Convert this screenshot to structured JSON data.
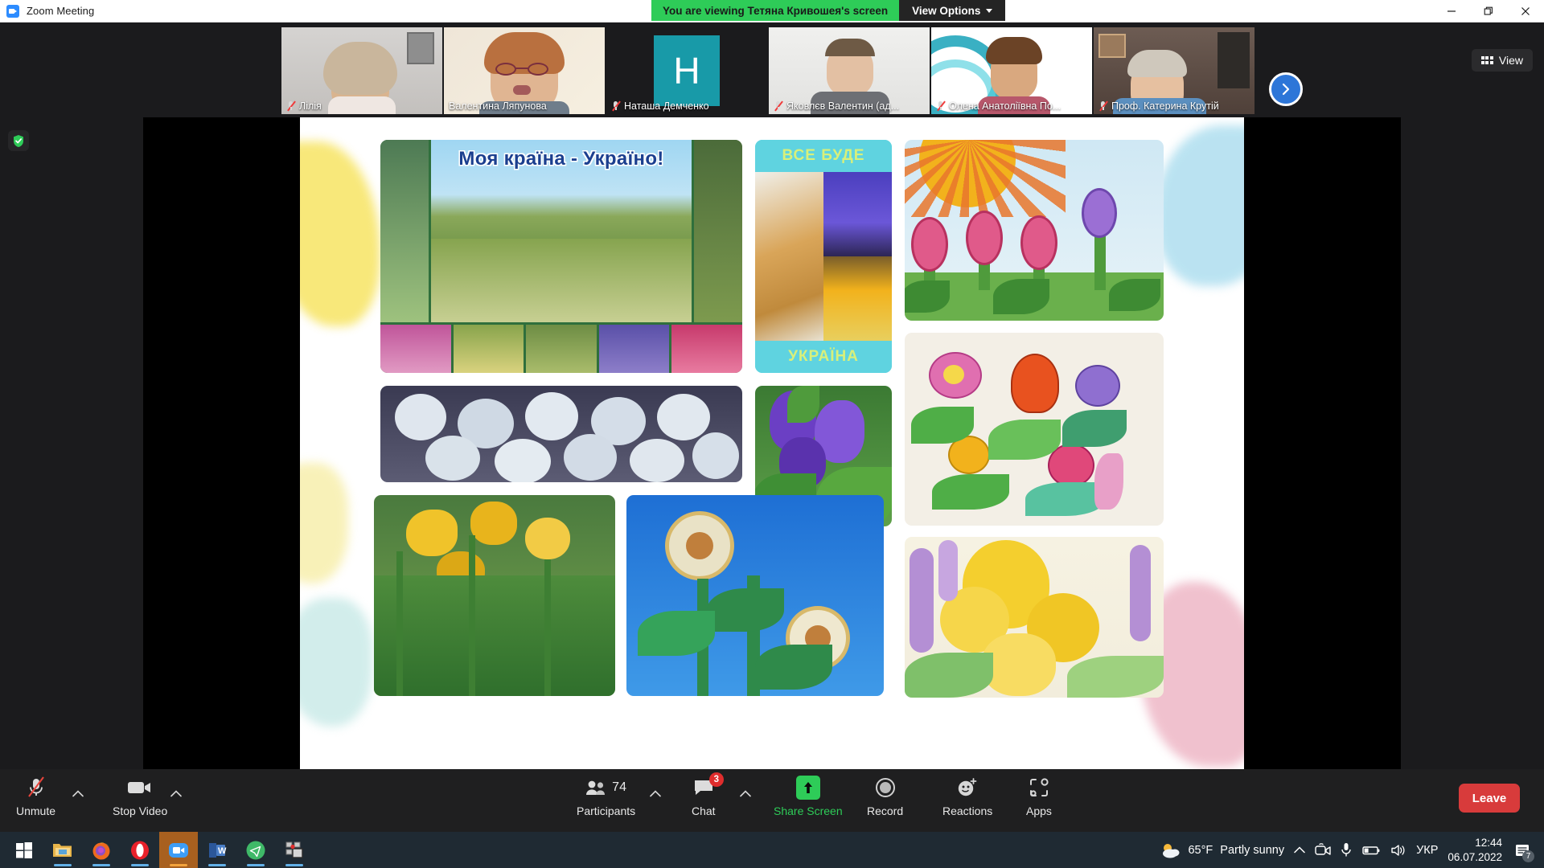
{
  "window": {
    "title": "Zoom Meeting",
    "app_icon": "zoom-icon",
    "minimize": "minimize-icon",
    "maximize": "restore-icon",
    "close": "close-icon"
  },
  "share_banner": {
    "viewing_text": "You are viewing Тетяна Кривошея's screen",
    "view_options_label": "View Options",
    "banner_color": "#2ecc58"
  },
  "top_right": {
    "view_label": "View"
  },
  "encryption": {
    "icon": "shield-check-icon"
  },
  "filmstrip": {
    "next_label": "next-participant-arrow",
    "participants": [
      {
        "name": "Лілія",
        "muted": true,
        "active": false,
        "type": "video"
      },
      {
        "name": "Валентина Ляпунова",
        "muted": false,
        "active": true,
        "type": "video"
      },
      {
        "name": "Наташа Демченко",
        "muted": true,
        "active": false,
        "type": "avatar",
        "initial": "Н",
        "avatar_color": "#189aa8"
      },
      {
        "name": "Яковлєв Валентин (ад...",
        "muted": true,
        "active": false,
        "type": "video"
      },
      {
        "name": "Олена Анатоліївна По...",
        "muted": true,
        "active": false,
        "type": "video"
      },
      {
        "name": "Проф. Катерина Крутій",
        "muted": true,
        "active": false,
        "type": "video"
      }
    ]
  },
  "shared_slide": {
    "collage_title": "Моя країна - Україно!",
    "banner_top": "ВСЕ БУДЕ",
    "banner_bottom": "УКРАЇНА"
  },
  "toolbar": {
    "mute_label": "Unmute",
    "video_label": "Stop Video",
    "participants_label": "Participants",
    "participants_count": "74",
    "chat_label": "Chat",
    "chat_badge": "3",
    "share_label": "Share Screen",
    "record_label": "Record",
    "reactions_label": "Reactions",
    "apps_label": "Apps",
    "leave_label": "Leave",
    "share_color": "#2ecc58",
    "leave_color": "#d83b3b"
  },
  "taskbar": {
    "apps": [
      {
        "name": "start-button",
        "icon": "windows-icon"
      },
      {
        "name": "file-explorer",
        "icon": "folder-icon"
      },
      {
        "name": "firefox",
        "icon": "firefox-icon"
      },
      {
        "name": "opera",
        "icon": "opera-icon"
      },
      {
        "name": "zoom",
        "icon": "zoom-icon"
      },
      {
        "name": "word",
        "icon": "word-icon"
      },
      {
        "name": "telegram",
        "icon": "telegram-icon"
      },
      {
        "name": "screenshot-tool",
        "icon": "capture-icon"
      }
    ],
    "weather_temp": "65°F",
    "weather_desc": "Partly sunny",
    "language": "УКР",
    "time": "12:44",
    "date": "06.07.2022",
    "notification_count": "7"
  }
}
